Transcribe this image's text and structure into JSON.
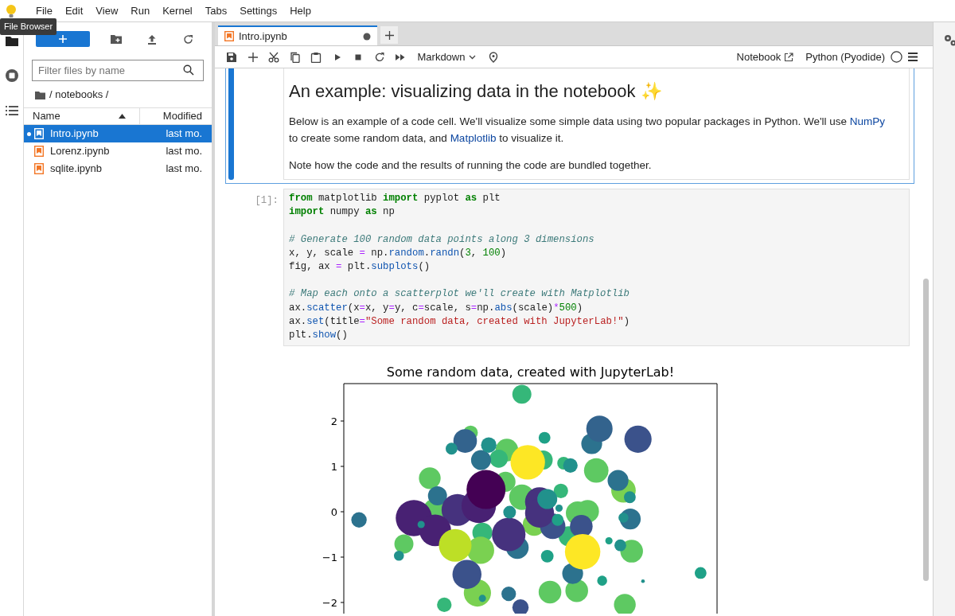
{
  "menu_bar": {
    "items": [
      "File",
      "Edit",
      "View",
      "Run",
      "Kernel",
      "Tabs",
      "Settings",
      "Help"
    ]
  },
  "tooltip": "File Browser",
  "activity_bar": {
    "items": [
      {
        "kind": "folder",
        "selected": true
      },
      {
        "kind": "running",
        "selected": false
      },
      {
        "kind": "toc",
        "selected": false
      }
    ]
  },
  "file_browser": {
    "filter_placeholder": "Filter files by name",
    "breadcrumb": "/ notebooks /",
    "columns": [
      "Name",
      "Modified"
    ],
    "files": [
      {
        "name": "Intro.ipynb",
        "modified": "last mo.",
        "selected": true,
        "running": true
      },
      {
        "name": "Lorenz.ipynb",
        "modified": "last mo.",
        "selected": false,
        "running": false
      },
      {
        "name": "sqlite.ipynb",
        "modified": "last mo.",
        "selected": false,
        "running": false
      }
    ]
  },
  "tabs": [
    {
      "label": "Intro.ipynb",
      "selected": true,
      "modified": true
    }
  ],
  "toolbar": {
    "cell_type": "Markdown",
    "notebook_link": "Notebook",
    "kernel": "Python (Pyodide)"
  },
  "markdown_cell": {
    "heading": "An example: visualizing data in the notebook ✨",
    "paragraphs": [
      [
        {
          "text": "Below is an example of a code cell. We'll visualize some simple data using two popular packages in Python. We'll use "
        },
        {
          "text": "NumPy",
          "link": true
        },
        {
          "text": " to create some random data, and "
        },
        {
          "text": "Matplotlib",
          "link": true
        },
        {
          "text": " to visualize it."
        }
      ],
      [
        {
          "text": "Note how the code and the results of running the code are bundled together."
        }
      ]
    ]
  },
  "code_cell": {
    "prompt": "[1]:",
    "blocks": [
      [
        [
          {
            "text": "from",
            "kind": "keyword"
          },
          {
            "text": " matplotlib ",
            "kind": "plain"
          },
          {
            "text": "import",
            "kind": "keyword"
          },
          {
            "text": " pyplot ",
            "kind": "plain"
          },
          {
            "text": "as",
            "kind": "keyword"
          },
          {
            "text": " plt",
            "kind": "plain"
          }
        ],
        [
          {
            "text": "import",
            "kind": "keyword"
          },
          {
            "text": " numpy ",
            "kind": "plain"
          },
          {
            "text": "as",
            "kind": "keyword"
          },
          {
            "text": " np",
            "kind": "plain"
          }
        ]
      ],
      [
        [
          {
            "text": "# Generate 100 random data points along 3 dimensions",
            "kind": "comment"
          }
        ],
        [
          {
            "text": "x, y, scale ",
            "kind": "plain"
          },
          {
            "text": "=",
            "kind": "operator"
          },
          {
            "text": " np.",
            "kind": "plain"
          },
          {
            "text": "random",
            "kind": "attribute"
          },
          {
            "text": ".",
            "kind": "plain"
          },
          {
            "text": "randn",
            "kind": "attribute"
          },
          {
            "text": "(",
            "kind": "plain"
          },
          {
            "text": "3",
            "kind": "number"
          },
          {
            "text": ", ",
            "kind": "plain"
          },
          {
            "text": "100",
            "kind": "number"
          },
          {
            "text": ")",
            "kind": "plain"
          }
        ],
        [
          {
            "text": "fig, ax ",
            "kind": "plain"
          },
          {
            "text": "=",
            "kind": "operator"
          },
          {
            "text": " plt.",
            "kind": "plain"
          },
          {
            "text": "subplots",
            "kind": "attribute"
          },
          {
            "text": "()",
            "kind": "plain"
          }
        ]
      ],
      [
        [
          {
            "text": "# Map each onto a scatterplot we'll create with Matplotlib",
            "kind": "comment"
          }
        ],
        [
          {
            "text": "ax.",
            "kind": "plain"
          },
          {
            "text": "scatter",
            "kind": "attribute"
          },
          {
            "text": "(x",
            "kind": "plain"
          },
          {
            "text": "=",
            "kind": "operator"
          },
          {
            "text": "x, y",
            "kind": "plain"
          },
          {
            "text": "=",
            "kind": "operator"
          },
          {
            "text": "y, c",
            "kind": "plain"
          },
          {
            "text": "=",
            "kind": "operator"
          },
          {
            "text": "scale, s",
            "kind": "plain"
          },
          {
            "text": "=",
            "kind": "operator"
          },
          {
            "text": "np.",
            "kind": "plain"
          },
          {
            "text": "abs",
            "kind": "attribute"
          },
          {
            "text": "(scale)",
            "kind": "plain"
          },
          {
            "text": "*",
            "kind": "operator"
          },
          {
            "text": "500",
            "kind": "number"
          },
          {
            "text": ")",
            "kind": "plain"
          }
        ],
        [
          {
            "text": "ax.",
            "kind": "plain"
          },
          {
            "text": "set",
            "kind": "attribute"
          },
          {
            "text": "(title",
            "kind": "plain"
          },
          {
            "text": "=",
            "kind": "operator"
          },
          {
            "text": "\"Some random data, created with JupyterLab!\"",
            "kind": "string"
          },
          {
            "text": ")",
            "kind": "plain"
          }
        ],
        [
          {
            "text": "plt.",
            "kind": "plain"
          },
          {
            "text": "show",
            "kind": "attribute"
          },
          {
            "text": "()",
            "kind": "plain"
          }
        ]
      ]
    ]
  },
  "output": {
    "plot": {
      "title": "Some random data, created with JupyterLab!",
      "y_tick_labels": [
        "2",
        "1",
        "0",
        "−1",
        "−2"
      ]
    }
  }
}
